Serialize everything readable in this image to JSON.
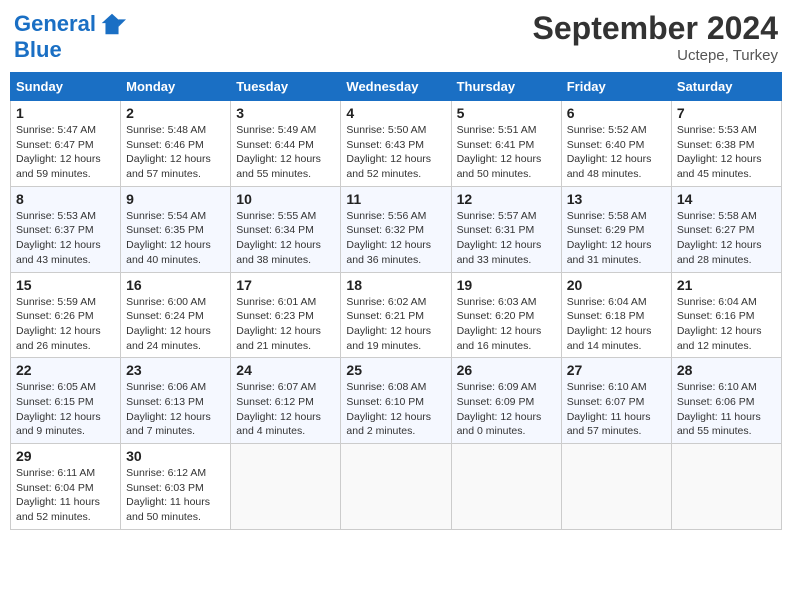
{
  "header": {
    "logo_line1": "General",
    "logo_line2": "Blue",
    "month": "September 2024",
    "location": "Uctepe, Turkey"
  },
  "columns": [
    "Sunday",
    "Monday",
    "Tuesday",
    "Wednesday",
    "Thursday",
    "Friday",
    "Saturday"
  ],
  "weeks": [
    [
      {
        "day": "1",
        "info": "Sunrise: 5:47 AM\nSunset: 6:47 PM\nDaylight: 12 hours\nand 59 minutes."
      },
      {
        "day": "2",
        "info": "Sunrise: 5:48 AM\nSunset: 6:46 PM\nDaylight: 12 hours\nand 57 minutes."
      },
      {
        "day": "3",
        "info": "Sunrise: 5:49 AM\nSunset: 6:44 PM\nDaylight: 12 hours\nand 55 minutes."
      },
      {
        "day": "4",
        "info": "Sunrise: 5:50 AM\nSunset: 6:43 PM\nDaylight: 12 hours\nand 52 minutes."
      },
      {
        "day": "5",
        "info": "Sunrise: 5:51 AM\nSunset: 6:41 PM\nDaylight: 12 hours\nand 50 minutes."
      },
      {
        "day": "6",
        "info": "Sunrise: 5:52 AM\nSunset: 6:40 PM\nDaylight: 12 hours\nand 48 minutes."
      },
      {
        "day": "7",
        "info": "Sunrise: 5:53 AM\nSunset: 6:38 PM\nDaylight: 12 hours\nand 45 minutes."
      }
    ],
    [
      {
        "day": "8",
        "info": "Sunrise: 5:53 AM\nSunset: 6:37 PM\nDaylight: 12 hours\nand 43 minutes."
      },
      {
        "day": "9",
        "info": "Sunrise: 5:54 AM\nSunset: 6:35 PM\nDaylight: 12 hours\nand 40 minutes."
      },
      {
        "day": "10",
        "info": "Sunrise: 5:55 AM\nSunset: 6:34 PM\nDaylight: 12 hours\nand 38 minutes."
      },
      {
        "day": "11",
        "info": "Sunrise: 5:56 AM\nSunset: 6:32 PM\nDaylight: 12 hours\nand 36 minutes."
      },
      {
        "day": "12",
        "info": "Sunrise: 5:57 AM\nSunset: 6:31 PM\nDaylight: 12 hours\nand 33 minutes."
      },
      {
        "day": "13",
        "info": "Sunrise: 5:58 AM\nSunset: 6:29 PM\nDaylight: 12 hours\nand 31 minutes."
      },
      {
        "day": "14",
        "info": "Sunrise: 5:58 AM\nSunset: 6:27 PM\nDaylight: 12 hours\nand 28 minutes."
      }
    ],
    [
      {
        "day": "15",
        "info": "Sunrise: 5:59 AM\nSunset: 6:26 PM\nDaylight: 12 hours\nand 26 minutes."
      },
      {
        "day": "16",
        "info": "Sunrise: 6:00 AM\nSunset: 6:24 PM\nDaylight: 12 hours\nand 24 minutes."
      },
      {
        "day": "17",
        "info": "Sunrise: 6:01 AM\nSunset: 6:23 PM\nDaylight: 12 hours\nand 21 minutes."
      },
      {
        "day": "18",
        "info": "Sunrise: 6:02 AM\nSunset: 6:21 PM\nDaylight: 12 hours\nand 19 minutes."
      },
      {
        "day": "19",
        "info": "Sunrise: 6:03 AM\nSunset: 6:20 PM\nDaylight: 12 hours\nand 16 minutes."
      },
      {
        "day": "20",
        "info": "Sunrise: 6:04 AM\nSunset: 6:18 PM\nDaylight: 12 hours\nand 14 minutes."
      },
      {
        "day": "21",
        "info": "Sunrise: 6:04 AM\nSunset: 6:16 PM\nDaylight: 12 hours\nand 12 minutes."
      }
    ],
    [
      {
        "day": "22",
        "info": "Sunrise: 6:05 AM\nSunset: 6:15 PM\nDaylight: 12 hours\nand 9 minutes."
      },
      {
        "day": "23",
        "info": "Sunrise: 6:06 AM\nSunset: 6:13 PM\nDaylight: 12 hours\nand 7 minutes."
      },
      {
        "day": "24",
        "info": "Sunrise: 6:07 AM\nSunset: 6:12 PM\nDaylight: 12 hours\nand 4 minutes."
      },
      {
        "day": "25",
        "info": "Sunrise: 6:08 AM\nSunset: 6:10 PM\nDaylight: 12 hours\nand 2 minutes."
      },
      {
        "day": "26",
        "info": "Sunrise: 6:09 AM\nSunset: 6:09 PM\nDaylight: 12 hours\nand 0 minutes."
      },
      {
        "day": "27",
        "info": "Sunrise: 6:10 AM\nSunset: 6:07 PM\nDaylight: 11 hours\nand 57 minutes."
      },
      {
        "day": "28",
        "info": "Sunrise: 6:10 AM\nSunset: 6:06 PM\nDaylight: 11 hours\nand 55 minutes."
      }
    ],
    [
      {
        "day": "29",
        "info": "Sunrise: 6:11 AM\nSunset: 6:04 PM\nDaylight: 11 hours\nand 52 minutes."
      },
      {
        "day": "30",
        "info": "Sunrise: 6:12 AM\nSunset: 6:03 PM\nDaylight: 11 hours\nand 50 minutes."
      },
      {
        "day": "",
        "info": ""
      },
      {
        "day": "",
        "info": ""
      },
      {
        "day": "",
        "info": ""
      },
      {
        "day": "",
        "info": ""
      },
      {
        "day": "",
        "info": ""
      }
    ]
  ]
}
